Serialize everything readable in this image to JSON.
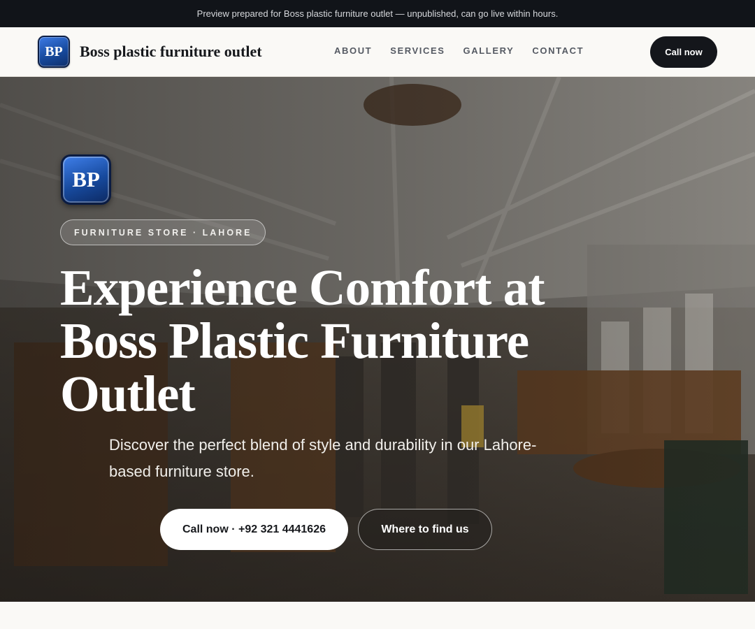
{
  "banner": {
    "text": "Preview prepared for Boss plastic furniture outlet — unpublished, can go live within hours."
  },
  "header": {
    "logo_text": "BP",
    "brand_name": "Boss plastic furniture outlet",
    "nav": [
      "ABOUT",
      "SERVICES",
      "GALLERY",
      "CONTACT"
    ],
    "cta_label": "Call now"
  },
  "hero": {
    "logo_text": "BP",
    "tag": "FURNITURE STORE · LAHORE",
    "title": "Experience Comfort at Boss Plastic Furniture Outlet",
    "subtitle": "Discover the perfect blend of style and durability in our Lahore-based furniture store.",
    "primary_button": "Call now · +92 321 4441626",
    "secondary_button": "Where to find us"
  },
  "colors": {
    "topbar_bg": "#111419",
    "brand_blue": "#174a9e",
    "dark_button": "#14161b",
    "page_bg": "#faf9f6"
  }
}
